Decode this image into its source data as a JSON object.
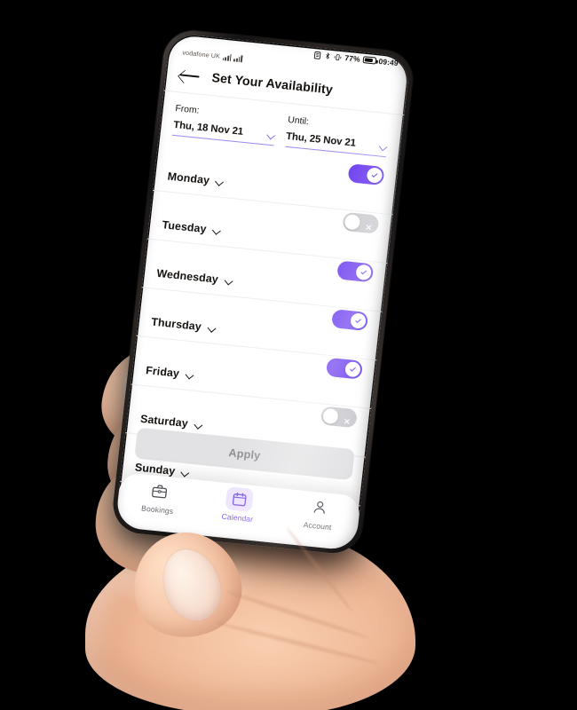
{
  "status_bar": {
    "carrier": "vodafone UK",
    "battery_percent": "77%",
    "time": "09:49",
    "signal_icon": "signal-bars-icon",
    "bluetooth_icon": "bluetooth-icon",
    "sim_icon": "sim-icon",
    "vibrate_icon": "vibrate-icon",
    "battery_icon": "battery-icon"
  },
  "header": {
    "back_icon": "back-arrow-icon",
    "title": "Set Your Availability"
  },
  "date_range": {
    "from": {
      "label": "From:",
      "value": "Thu, 18 Nov 21",
      "chevron_icon": "chevron-down-icon"
    },
    "until": {
      "label": "Until:",
      "value": "Thu, 25 Nov 21",
      "chevron_icon": "chevron-down-icon"
    }
  },
  "days": [
    {
      "name": "Monday",
      "enabled": true,
      "toggle_icon": "check-icon",
      "chevron_icon": "chevron-down-icon"
    },
    {
      "name": "Tuesday",
      "enabled": false,
      "toggle_icon": "cross-icon",
      "chevron_icon": "chevron-down-icon"
    },
    {
      "name": "Wednesday",
      "enabled": true,
      "toggle_icon": "check-icon",
      "chevron_icon": "chevron-down-icon"
    },
    {
      "name": "Thursday",
      "enabled": true,
      "toggle_icon": "check-icon",
      "chevron_icon": "chevron-down-icon"
    },
    {
      "name": "Friday",
      "enabled": true,
      "toggle_icon": "check-icon",
      "chevron_icon": "chevron-down-icon"
    },
    {
      "name": "Saturday",
      "enabled": false,
      "toggle_icon": "cross-icon",
      "chevron_icon": "chevron-down-icon"
    },
    {
      "name": "Sunday",
      "enabled": false,
      "toggle_icon": "cross-icon",
      "chevron_icon": "chevron-down-icon"
    }
  ],
  "apply_button": {
    "label": "Apply"
  },
  "bottom_nav": {
    "items": [
      {
        "label": "Bookings",
        "icon": "briefcase-icon",
        "active": false
      },
      {
        "label": "Calendar",
        "icon": "calendar-icon",
        "active": true
      },
      {
        "label": "Account",
        "icon": "person-icon",
        "active": false
      }
    ]
  },
  "colors": {
    "accent_purple": "#6B3CF0",
    "accent_purple_light": "#ece4ff",
    "toggle_off_gray": "#c9c9ce",
    "apply_bg": "#e2e2e4",
    "apply_text": "#8d8d93",
    "underline_purple": "#9f86f2",
    "background": "#000000"
  }
}
